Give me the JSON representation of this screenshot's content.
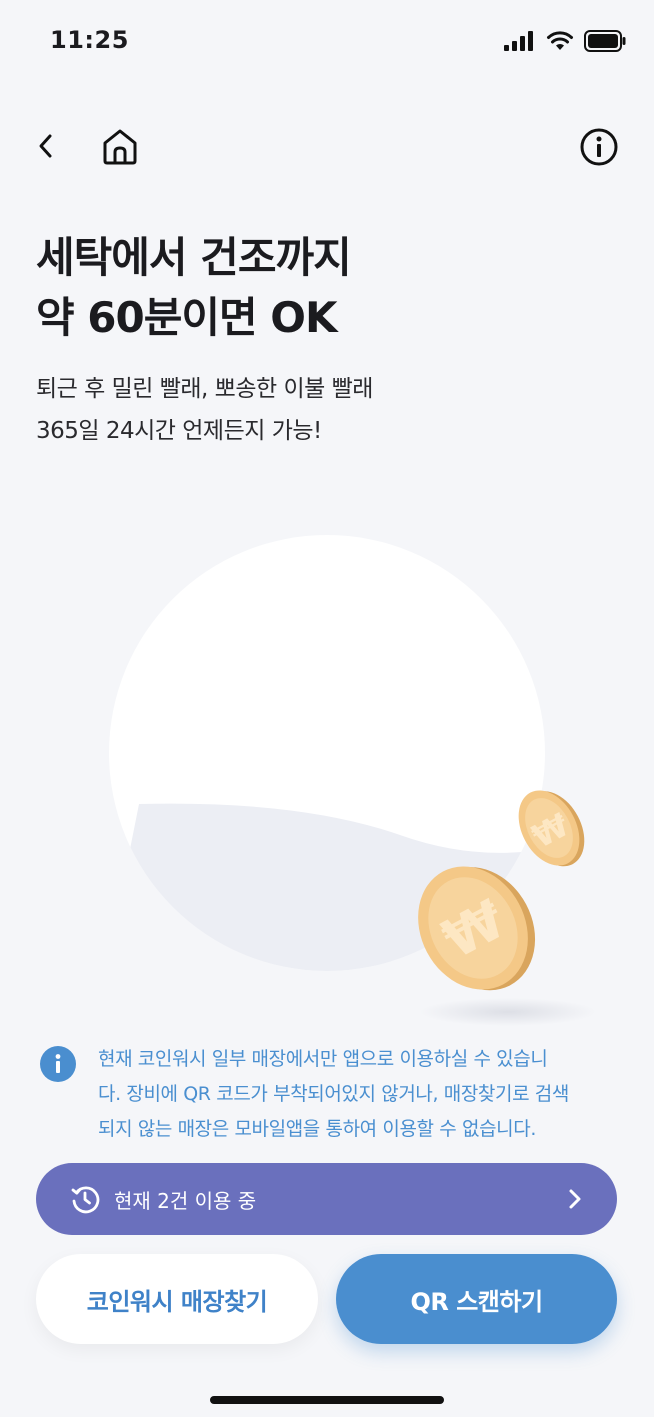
{
  "status_bar": {
    "time": "11:25"
  },
  "header": {
    "back_icon": "chevron-left-icon",
    "home_icon": "home-icon",
    "info_icon": "info-circle-icon"
  },
  "hero": {
    "title_line1": "세탁에서 건조까지",
    "title_line2": "약 60분이면 OK",
    "subtitle_line1": "퇴근 후 밀린 빨래, 뽀송한 이불 빨래",
    "subtitle_line2": "365일 24시간 언제든지 가능!",
    "illustration": "washing-machine-window-with-won-coins"
  },
  "notice": {
    "icon": "info-icon",
    "line1": "현재 코인워시 일부 매장에서만 앱으로 이용하실 수 있습니",
    "line2": "다. 장비에 QR 코드가 부착되어있지 않거나, 매장찾기로 검색",
    "line3": "되지 않는 매장은 모바일앱을 통하여 이용할 수 없습니다."
  },
  "usage": {
    "label": "현재 2건 이용 중",
    "icon": "history-icon",
    "arrow_icon": "chevron-right-icon"
  },
  "actions": {
    "find_store": "코인워시 매장찾기",
    "qr_scan": "QR 스캔하기"
  },
  "colors": {
    "accent_blue": "#4a8ecf",
    "usage_purple": "#6a70bd",
    "coin_gold": "#f4c887",
    "background": "#f5f6f9"
  }
}
